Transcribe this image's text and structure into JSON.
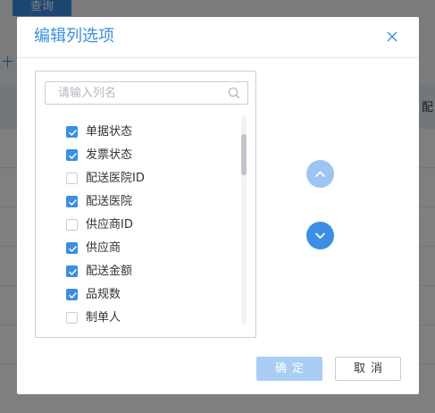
{
  "background": {
    "query_label": "查询",
    "new_label": "十 新",
    "header_peek": "配"
  },
  "dialog": {
    "title": "编辑列选项",
    "search": {
      "placeholder": "请输入列名",
      "value": ""
    },
    "columns": [
      {
        "label": "单据状态",
        "checked": true
      },
      {
        "label": "发票状态",
        "checked": true
      },
      {
        "label": "配送医院ID",
        "checked": false
      },
      {
        "label": "配送医院",
        "checked": true
      },
      {
        "label": "供应商ID",
        "checked": false
      },
      {
        "label": "供应商",
        "checked": true
      },
      {
        "label": "配送金额",
        "checked": true
      },
      {
        "label": "品规数",
        "checked": true
      },
      {
        "label": "制单人",
        "checked": false
      }
    ],
    "buttons": {
      "ok": "确定",
      "cancel": "取消"
    },
    "colors": {
      "accent": "#3a8ee6",
      "accent_disabled": "#a9cdf5"
    },
    "icons": [
      "close-icon",
      "search-icon",
      "check-icon",
      "chevron-up-icon",
      "chevron-down-icon"
    ]
  }
}
